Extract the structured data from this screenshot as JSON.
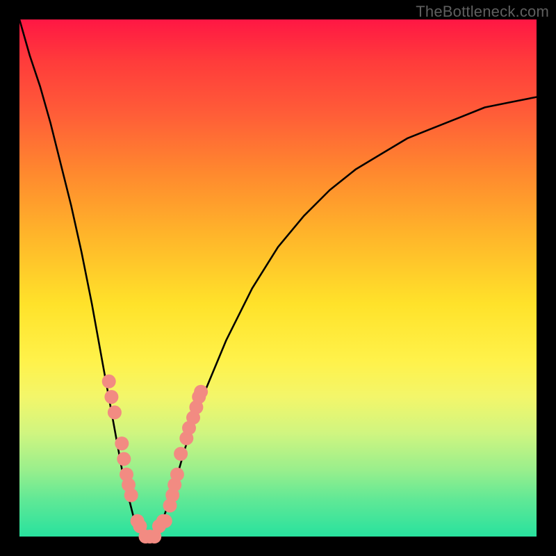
{
  "watermark": "TheBottleneck.com",
  "chart_data": {
    "type": "line",
    "title": "",
    "xlabel": "",
    "ylabel": "",
    "xlim": [
      0,
      100
    ],
    "ylim": [
      0,
      100
    ],
    "grid": false,
    "legend": false,
    "background_gradient": {
      "orientation": "vertical",
      "top_color": "#ff1744",
      "bottom_color": "#28e29e",
      "meaning": "top = high bottleneck, bottom = low bottleneck"
    },
    "series": [
      {
        "name": "bottleneck-curve",
        "color": "#000000",
        "x": [
          0,
          2,
          4,
          6,
          8,
          10,
          12,
          14,
          16,
          18,
          20,
          22,
          23,
          24,
          25,
          26,
          27,
          28,
          30,
          32,
          35,
          40,
          45,
          50,
          55,
          60,
          65,
          70,
          75,
          80,
          85,
          90,
          95,
          100
        ],
        "y": [
          100,
          93,
          87,
          80,
          72,
          64,
          55,
          45,
          34,
          23,
          12,
          4,
          2,
          0,
          0,
          0,
          2,
          4,
          10,
          17,
          26,
          38,
          48,
          56,
          62,
          67,
          71,
          74,
          77,
          79,
          81,
          83,
          84,
          85
        ]
      }
    ],
    "markers": {
      "name": "sample-dots",
      "color": "#f28b82",
      "radius_px": 10,
      "points": [
        {
          "x": 17.3,
          "y": 30
        },
        {
          "x": 17.8,
          "y": 27
        },
        {
          "x": 18.4,
          "y": 24
        },
        {
          "x": 19.8,
          "y": 18
        },
        {
          "x": 20.2,
          "y": 15
        },
        {
          "x": 20.7,
          "y": 12
        },
        {
          "x": 21.1,
          "y": 10
        },
        {
          "x": 21.6,
          "y": 8
        },
        {
          "x": 22.8,
          "y": 3
        },
        {
          "x": 23.3,
          "y": 2
        },
        {
          "x": 24.4,
          "y": 0
        },
        {
          "x": 25.2,
          "y": 0
        },
        {
          "x": 26.1,
          "y": 0
        },
        {
          "x": 27.0,
          "y": 2
        },
        {
          "x": 27.8,
          "y": 3
        },
        {
          "x": 28.2,
          "y": 3
        },
        {
          "x": 29.1,
          "y": 6
        },
        {
          "x": 29.6,
          "y": 8
        },
        {
          "x": 30.0,
          "y": 10
        },
        {
          "x": 30.5,
          "y": 12
        },
        {
          "x": 31.2,
          "y": 16
        },
        {
          "x": 32.3,
          "y": 19
        },
        {
          "x": 32.8,
          "y": 21
        },
        {
          "x": 33.6,
          "y": 23
        },
        {
          "x": 34.2,
          "y": 25
        },
        {
          "x": 34.7,
          "y": 27
        },
        {
          "x": 35.1,
          "y": 28
        }
      ]
    }
  }
}
